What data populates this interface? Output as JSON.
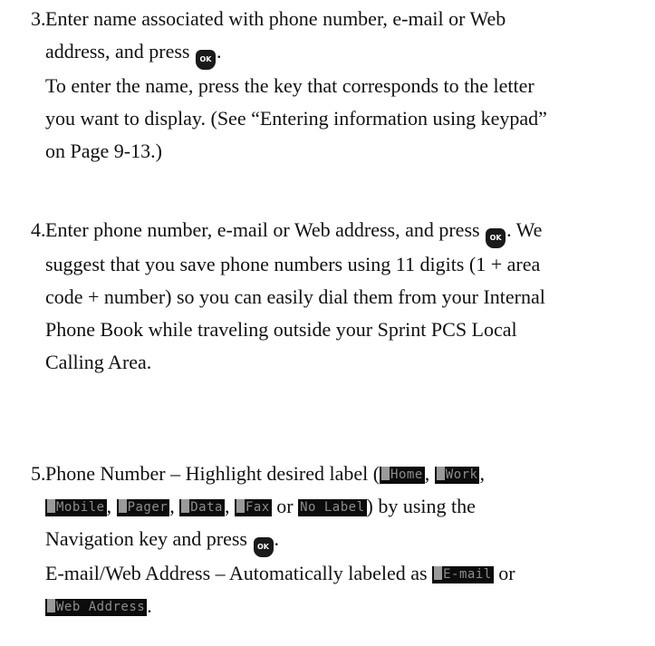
{
  "steps": [
    {
      "num": "3.",
      "l1": "Enter name associated with phone number, e-mail or Web",
      "l2a": "address, and press",
      "l2b": ".",
      "l3": "To enter the name, press the key that corresponds to the letter",
      "l4": "you want to display. (See “Entering information using keypad”",
      "l5": "on Page 9-13.)"
    },
    {
      "num": "4.",
      "l1a": "Enter phone number, e-mail or Web address, and press",
      "l1b": ". We",
      "l2": "suggest that you save phone numbers using 11 digits (1 + area",
      "l3": "code + number) so you can easily dial them from your Internal",
      "l4": "Phone Book while traveling outside your Sprint PCS Local",
      "l5": "Calling Area."
    },
    {
      "num": "5.",
      "l1a": "Phone Number – Highlight desired label (",
      "l1b": ", ",
      "l1c": ",",
      "l2a": ", ",
      "l2b": ", ",
      "l2c": ", ",
      "l2d": " or ",
      "l2e": ") by using the",
      "l3a": "Navigation key and press",
      "l3b": ".",
      "l4a": "E-mail/Web Address – Automatically labeled as",
      "l4b": " or",
      "l5b": "."
    }
  ],
  "ok_key_label": "OK",
  "labels": {
    "home": "Home",
    "work": "Work",
    "mobile": "Mobile",
    "pager": "Pager",
    "data": "Data",
    "fax": "Fax",
    "no_label": "No Label",
    "email": "E-mail",
    "web": "Web Address"
  }
}
